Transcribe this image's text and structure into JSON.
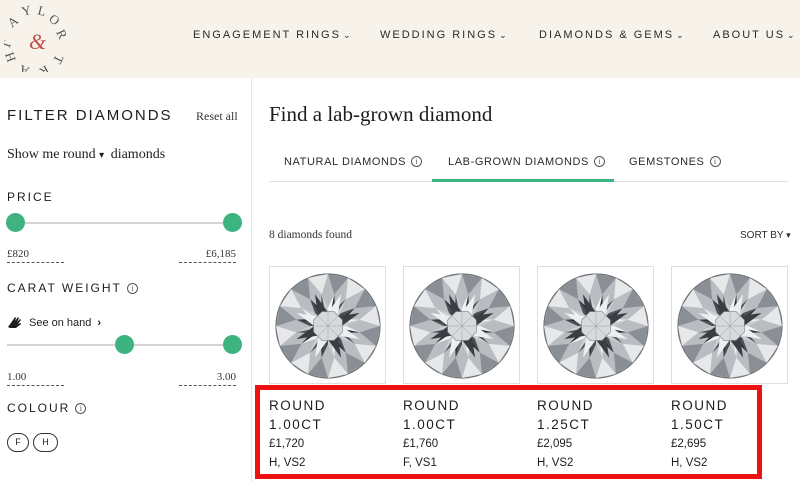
{
  "header": {
    "logo_letters": "TAYLOR & HART",
    "nav": [
      {
        "label": "ENGAGEMENT RINGS"
      },
      {
        "label": "WEDDING RINGS"
      },
      {
        "label": "DIAMONDS & GEMS"
      },
      {
        "label": "ABOUT US"
      }
    ]
  },
  "sidebar": {
    "title": "FILTER DIAMONDS",
    "reset_label": "Reset all",
    "showme_prefix": "Show me",
    "showme_shape": "round",
    "showme_suffix": "diamonds",
    "price": {
      "label": "PRICE",
      "min": "£820",
      "max": "£6,185"
    },
    "carat": {
      "label": "CARAT WEIGHT",
      "see_on_hand": "See on hand",
      "min": "1.00",
      "max": "3.00"
    },
    "colour": {
      "label": "COLOUR",
      "chips": [
        "F",
        "H"
      ]
    }
  },
  "main": {
    "title": "Find a lab-grown diamond",
    "tabs": [
      {
        "label": "NATURAL DIAMONDS"
      },
      {
        "label": "LAB-GROWN DIAMONDS",
        "active": true
      },
      {
        "label": "GEMSTONES"
      }
    ],
    "found_text": "8 diamonds found",
    "sort_label": "SORT BY",
    "diamonds": [
      {
        "shape": "ROUND",
        "carat": "1.00CT",
        "price": "£1,720",
        "grade": "H, VS2"
      },
      {
        "shape": "ROUND",
        "carat": "1.00CT",
        "price": "£1,760",
        "grade": "F, VS1"
      },
      {
        "shape": "ROUND",
        "carat": "1.25CT",
        "price": "£2,095",
        "grade": "H, VS2"
      },
      {
        "shape": "ROUND",
        "carat": "1.50CT",
        "price": "£2,695",
        "grade": "H, VS2"
      }
    ]
  },
  "colors": {
    "accent_green": "#3db37f",
    "header_bg": "#f7f2ea",
    "logo_red": "#c0504a",
    "highlight_red": "#ee1111"
  }
}
